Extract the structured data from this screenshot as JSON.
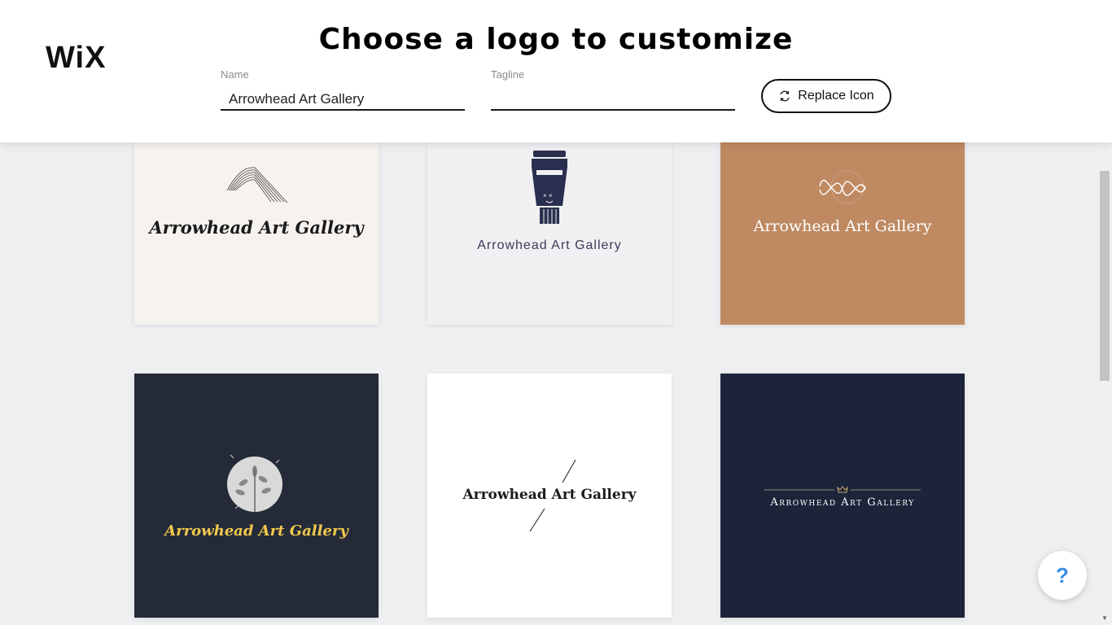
{
  "header": {
    "brand": "WiX",
    "title": "Choose a logo to customize",
    "name_field": {
      "label": "Name",
      "value": "Arrowhead Art Gallery"
    },
    "tagline_field": {
      "label": "Tagline",
      "value": "",
      "placeholder": ""
    },
    "replace_icon_label": "Replace Icon"
  },
  "logos": [
    {
      "text": "Arrowhead Art Gallery",
      "background": "#f6f2ef",
      "text_color": "#1a1a1a",
      "icon": "paper-fold-icon"
    },
    {
      "text": "Arrowhead Art Gallery",
      "background": "#f0f0f2",
      "text_color": "#3a3a5a",
      "icon": "paint-tube-icon"
    },
    {
      "text": "Arrowhead Art Gallery",
      "background": "#bf8a62",
      "text_color": "#ffffff",
      "icon": "wave-orb-icon"
    },
    {
      "text": "Arrowhead Art Gallery",
      "background": "#242a38",
      "text_color": "#f2c94c",
      "icon": "plant-circle-icon"
    },
    {
      "text": "Arrowhead Art Gallery",
      "background": "#ffffff",
      "text_color": "#1a1a1a",
      "icon": "slash-lines-icon"
    },
    {
      "text": "Arrowhead Art Gallery",
      "background": "#1c2439",
      "text_color": "#ffffff",
      "icon": "crown-icon"
    }
  ],
  "help": {
    "label": "?"
  }
}
